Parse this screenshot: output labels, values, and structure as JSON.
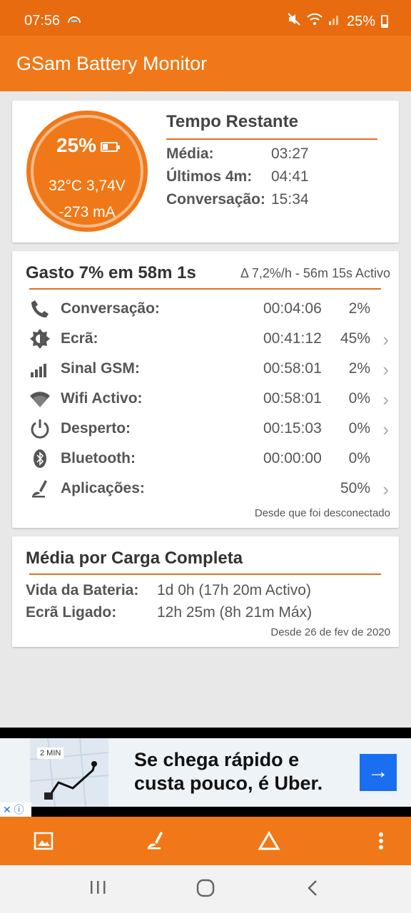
{
  "statusbar": {
    "time": "07:56",
    "battery": "25%"
  },
  "app": {
    "title": "GSam Battery Monitor"
  },
  "summary": {
    "percent": "25%",
    "temp_voltage": "32°C  3,74V",
    "current": "-273 mA",
    "remaining_title": "Tempo Restante",
    "rows": [
      {
        "label": "Média:",
        "value": "03:27"
      },
      {
        "label": "Últimos 4m:",
        "value": "04:41"
      },
      {
        "label": "Conversação:",
        "value": "15:34"
      }
    ]
  },
  "usage": {
    "heading": "Gasto 7% em 58m 1s",
    "stat": "Δ 7,2%/h - 56m 15s Activo",
    "items": [
      {
        "icon": "phone-icon",
        "label": "Conversação:",
        "duration": "00:04:06",
        "percent": "2%"
      },
      {
        "icon": "brightness-icon",
        "label": "Ecrã:",
        "duration": "00:41:12",
        "percent": "45%"
      },
      {
        "icon": "signal-icon",
        "label": "Sinal GSM:",
        "duration": "00:58:01",
        "percent": "2%"
      },
      {
        "icon": "wifi-icon",
        "label": "Wifi Activo:",
        "duration": "00:58:01",
        "percent": "0%"
      },
      {
        "icon": "power-icon",
        "label": "Desperto:",
        "duration": "00:15:03",
        "percent": "0%"
      },
      {
        "icon": "bluetooth-icon",
        "label": "Bluetooth:",
        "duration": "00:00:00",
        "percent": "0%"
      },
      {
        "icon": "apps-icon",
        "label": "Aplicações:",
        "duration": "",
        "percent": "50%"
      }
    ],
    "since": "Desde que foi desconectado"
  },
  "average": {
    "heading": "Média por Carga Completa",
    "rows": [
      {
        "label": "Vida da Bateria:",
        "value": "1d 0h (17h 20m Activo)"
      },
      {
        "label": "Ecrã Ligado:",
        "value": "12h 25m (8h 21m Máx)"
      }
    ],
    "since": "Desde 26 de fev de 2020"
  },
  "ad": {
    "chip": "2 MIN",
    "line1": "Se chega rápido e",
    "line2": "custa pouco, é Uber.",
    "go_label": "→"
  },
  "colors": {
    "accent": "#f07818",
    "statusbar": "#e86b10",
    "rule": "#e07020"
  }
}
